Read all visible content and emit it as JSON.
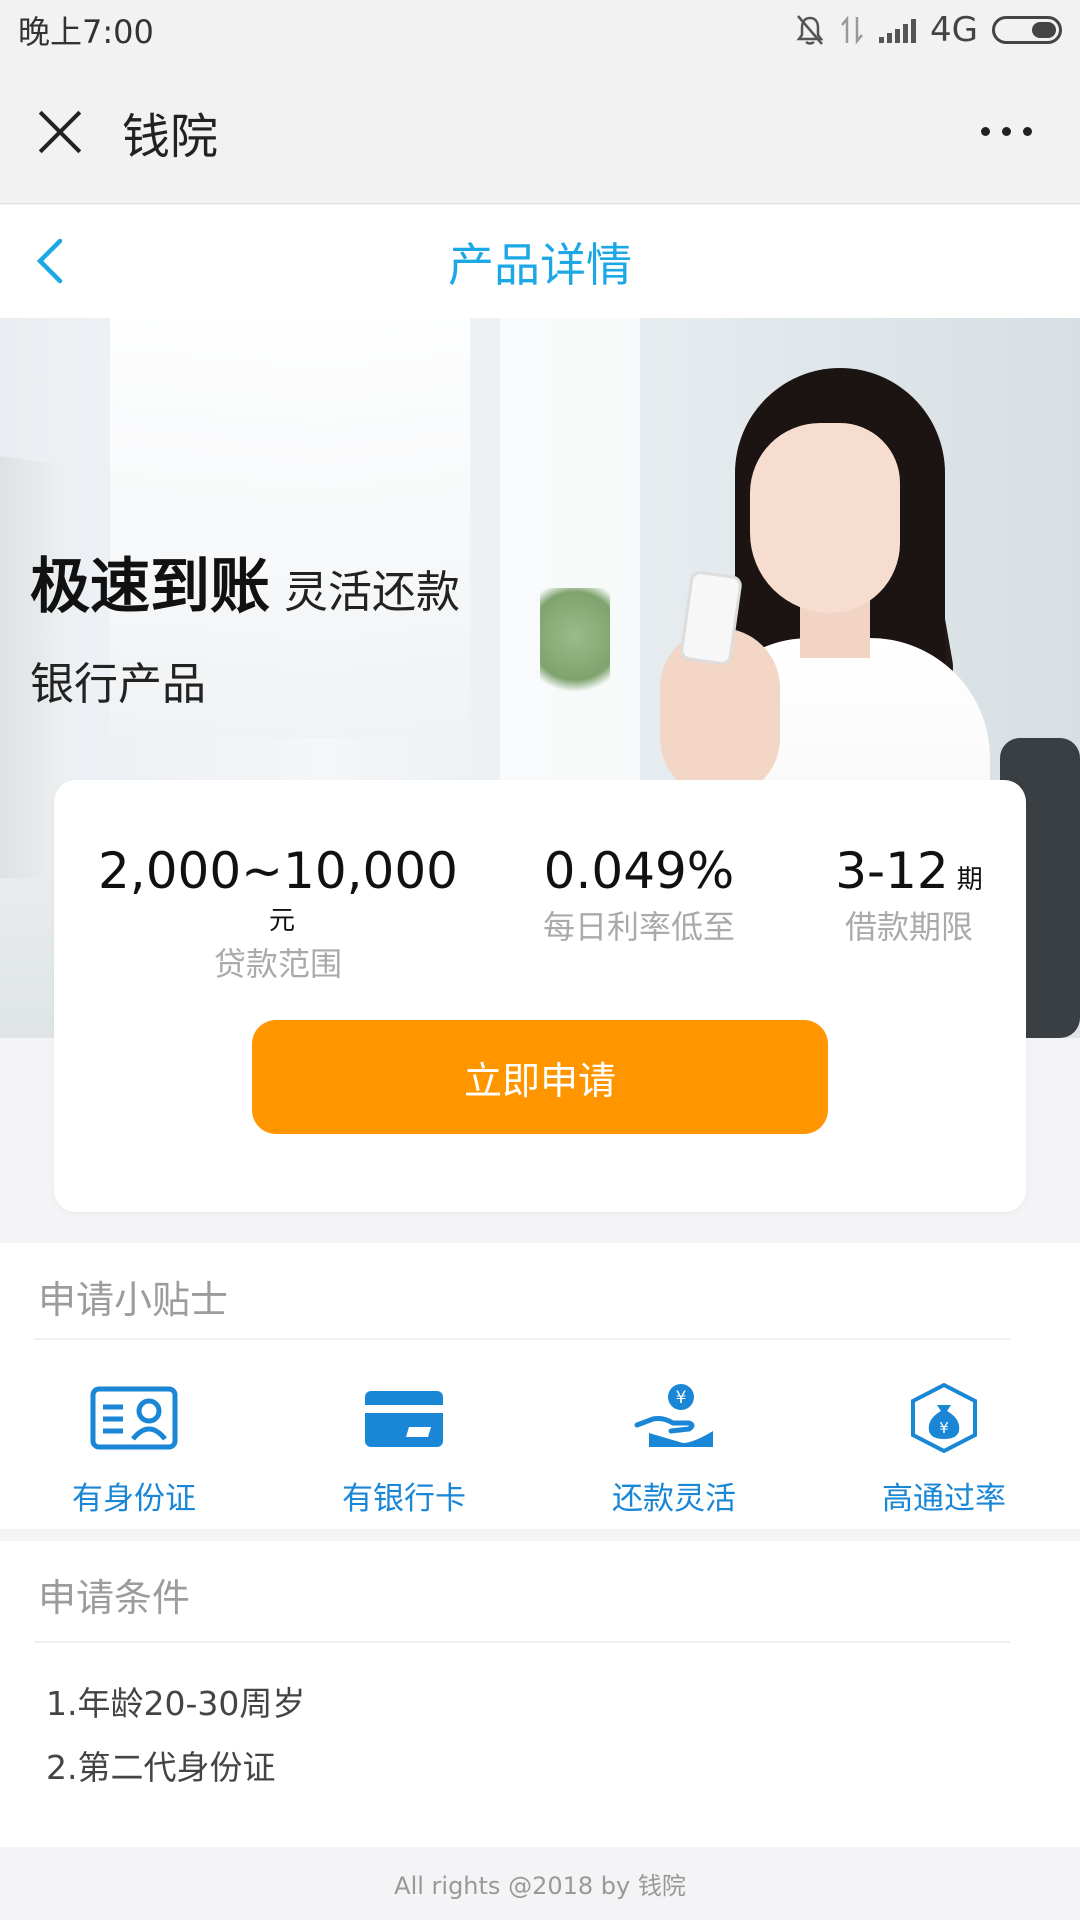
{
  "status_bar": {
    "time": "晚上7:00",
    "network": "4G"
  },
  "webview": {
    "title": "钱院"
  },
  "header": {
    "title": "产品详情"
  },
  "hero": {
    "headline_bold": "极速到账",
    "headline_light": "灵活还款",
    "subtitle": "银行产品"
  },
  "card": {
    "stats": [
      {
        "value": "2,000~10,000",
        "unit": "元",
        "label": "贷款范围"
      },
      {
        "value": "0.049%",
        "unit": "",
        "label": "每日利率低至"
      },
      {
        "value": "3-12",
        "unit": "期",
        "label": "借款期限"
      }
    ],
    "apply_label": "立即申请"
  },
  "tips": {
    "title": "申请小贴士",
    "items": [
      {
        "label": "有身份证",
        "icon": "id-card-icon"
      },
      {
        "label": "有银行卡",
        "icon": "bank-card-icon"
      },
      {
        "label": "还款灵活",
        "icon": "hand-coin-icon"
      },
      {
        "label": "高通过率",
        "icon": "money-bag-icon"
      }
    ]
  },
  "conditions": {
    "title": "申请条件",
    "items": [
      "1.年龄20-30周岁",
      "2.第二代身份证"
    ]
  },
  "footer": {
    "text": "All rights @2018 by 钱院"
  },
  "colors": {
    "accent": "#1ca8e4",
    "button": "#ff9600",
    "icon_blue": "#1a86d6"
  }
}
